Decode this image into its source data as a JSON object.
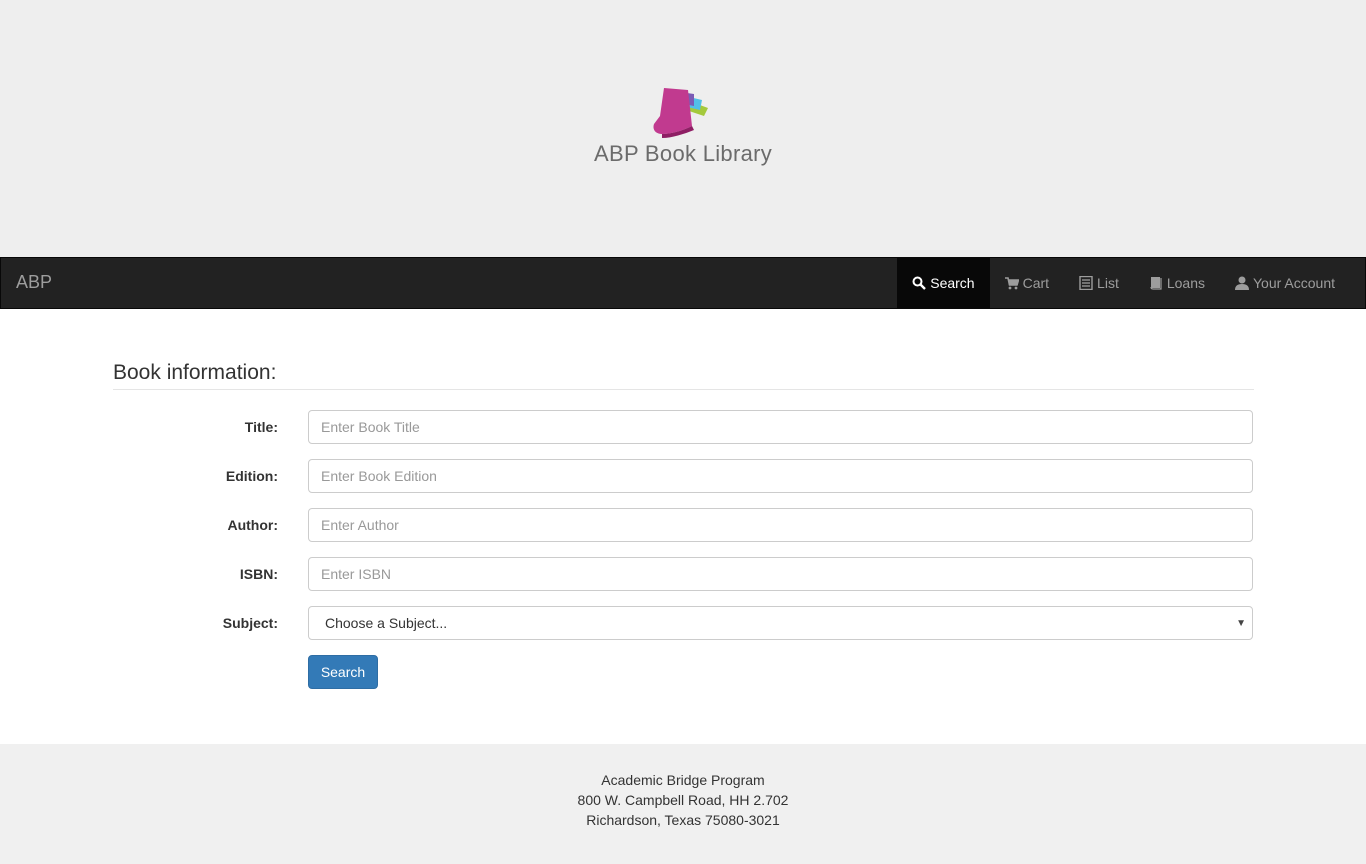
{
  "header": {
    "logo_text": "ABP Book Library"
  },
  "navbar": {
    "brand": "ABP",
    "items": [
      {
        "label": "Search",
        "icon": "search-icon",
        "active": true
      },
      {
        "label": "Cart",
        "icon": "cart-icon"
      },
      {
        "label": "List",
        "icon": "list-icon"
      },
      {
        "label": "Loans",
        "icon": "book-icon"
      },
      {
        "label": "Your Account",
        "icon": "user-icon"
      }
    ]
  },
  "form": {
    "legend": "Book information:",
    "title": {
      "label": "Title:",
      "placeholder": "Enter Book Title"
    },
    "edition": {
      "label": "Edition:",
      "placeholder": "Enter Book Edition"
    },
    "author": {
      "label": "Author:",
      "placeholder": "Enter Author"
    },
    "isbn": {
      "label": "ISBN:",
      "placeholder": "Enter ISBN"
    },
    "subject": {
      "label": "Subject:",
      "selected": "Choose a Subject..."
    },
    "search_button": "Search"
  },
  "footer": {
    "line1": "Academic Bridge Program",
    "line2": "800 W. Campbell Road, HH 2.702",
    "line3": "Richardson, Texas 75080-3021"
  },
  "colors": {
    "primary": "#337ab7",
    "navbar": "#222222",
    "hero_bg": "#eeeeee"
  }
}
